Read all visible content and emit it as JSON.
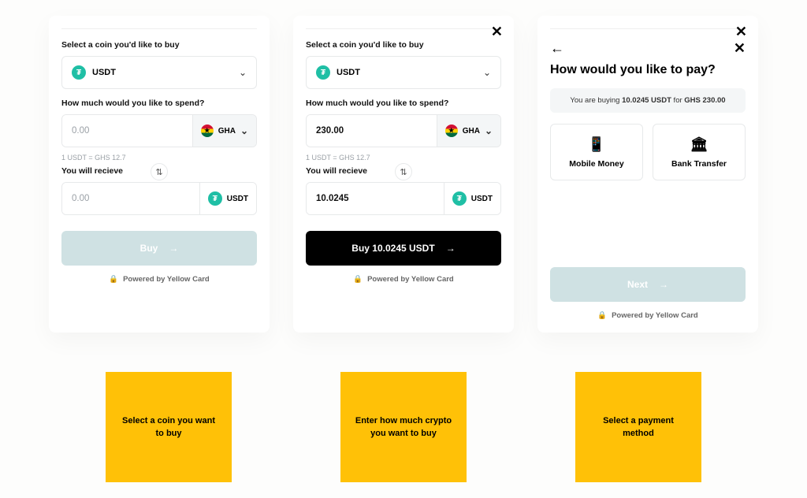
{
  "card1": {
    "select_label": "Select a coin you'd like to buy",
    "coin": "USDT",
    "spend_label": "How much would you like to spend?",
    "spend_value": "0.00",
    "currency": "GHA",
    "rate": "1 USDT = GHS 12.7",
    "receive_label": "You will recieve",
    "receive_value": "0.00",
    "receive_coin": "USDT",
    "cta": "Buy",
    "footer": "Powered by Yellow Card"
  },
  "card2": {
    "select_label": "Select a coin you'd like to buy",
    "coin": "USDT",
    "spend_label": "How much would you like to spend?",
    "spend_value": "230.00",
    "currency": "GHA",
    "rate": "1 USDT = GHS 12.7",
    "receive_label": "You will recieve",
    "receive_value": "10.0245",
    "receive_coin": "USDT",
    "cta": "Buy 10.0245 USDT",
    "footer": "Powered by Yellow Card"
  },
  "card3": {
    "heading": "How would you like to pay?",
    "info_pre": "You are buying ",
    "info_amount": "10.0245 USDT",
    "info_mid": " for ",
    "info_price": "GHS 230.00",
    "option1": "Mobile Money",
    "option2": "Bank Transfer",
    "cta": "Next",
    "footer": "Powered by Yellow Card"
  },
  "notes": {
    "n1": "Select a coin you want to buy",
    "n2": "Enter how much crypto you want to buy",
    "n3": "Select a payment method"
  },
  "glyphs": {
    "close": "✕",
    "back": "←",
    "swap": "⇅",
    "chevron": "⌄",
    "lock": "🔒",
    "phone": "📱",
    "bank": "🏛"
  }
}
